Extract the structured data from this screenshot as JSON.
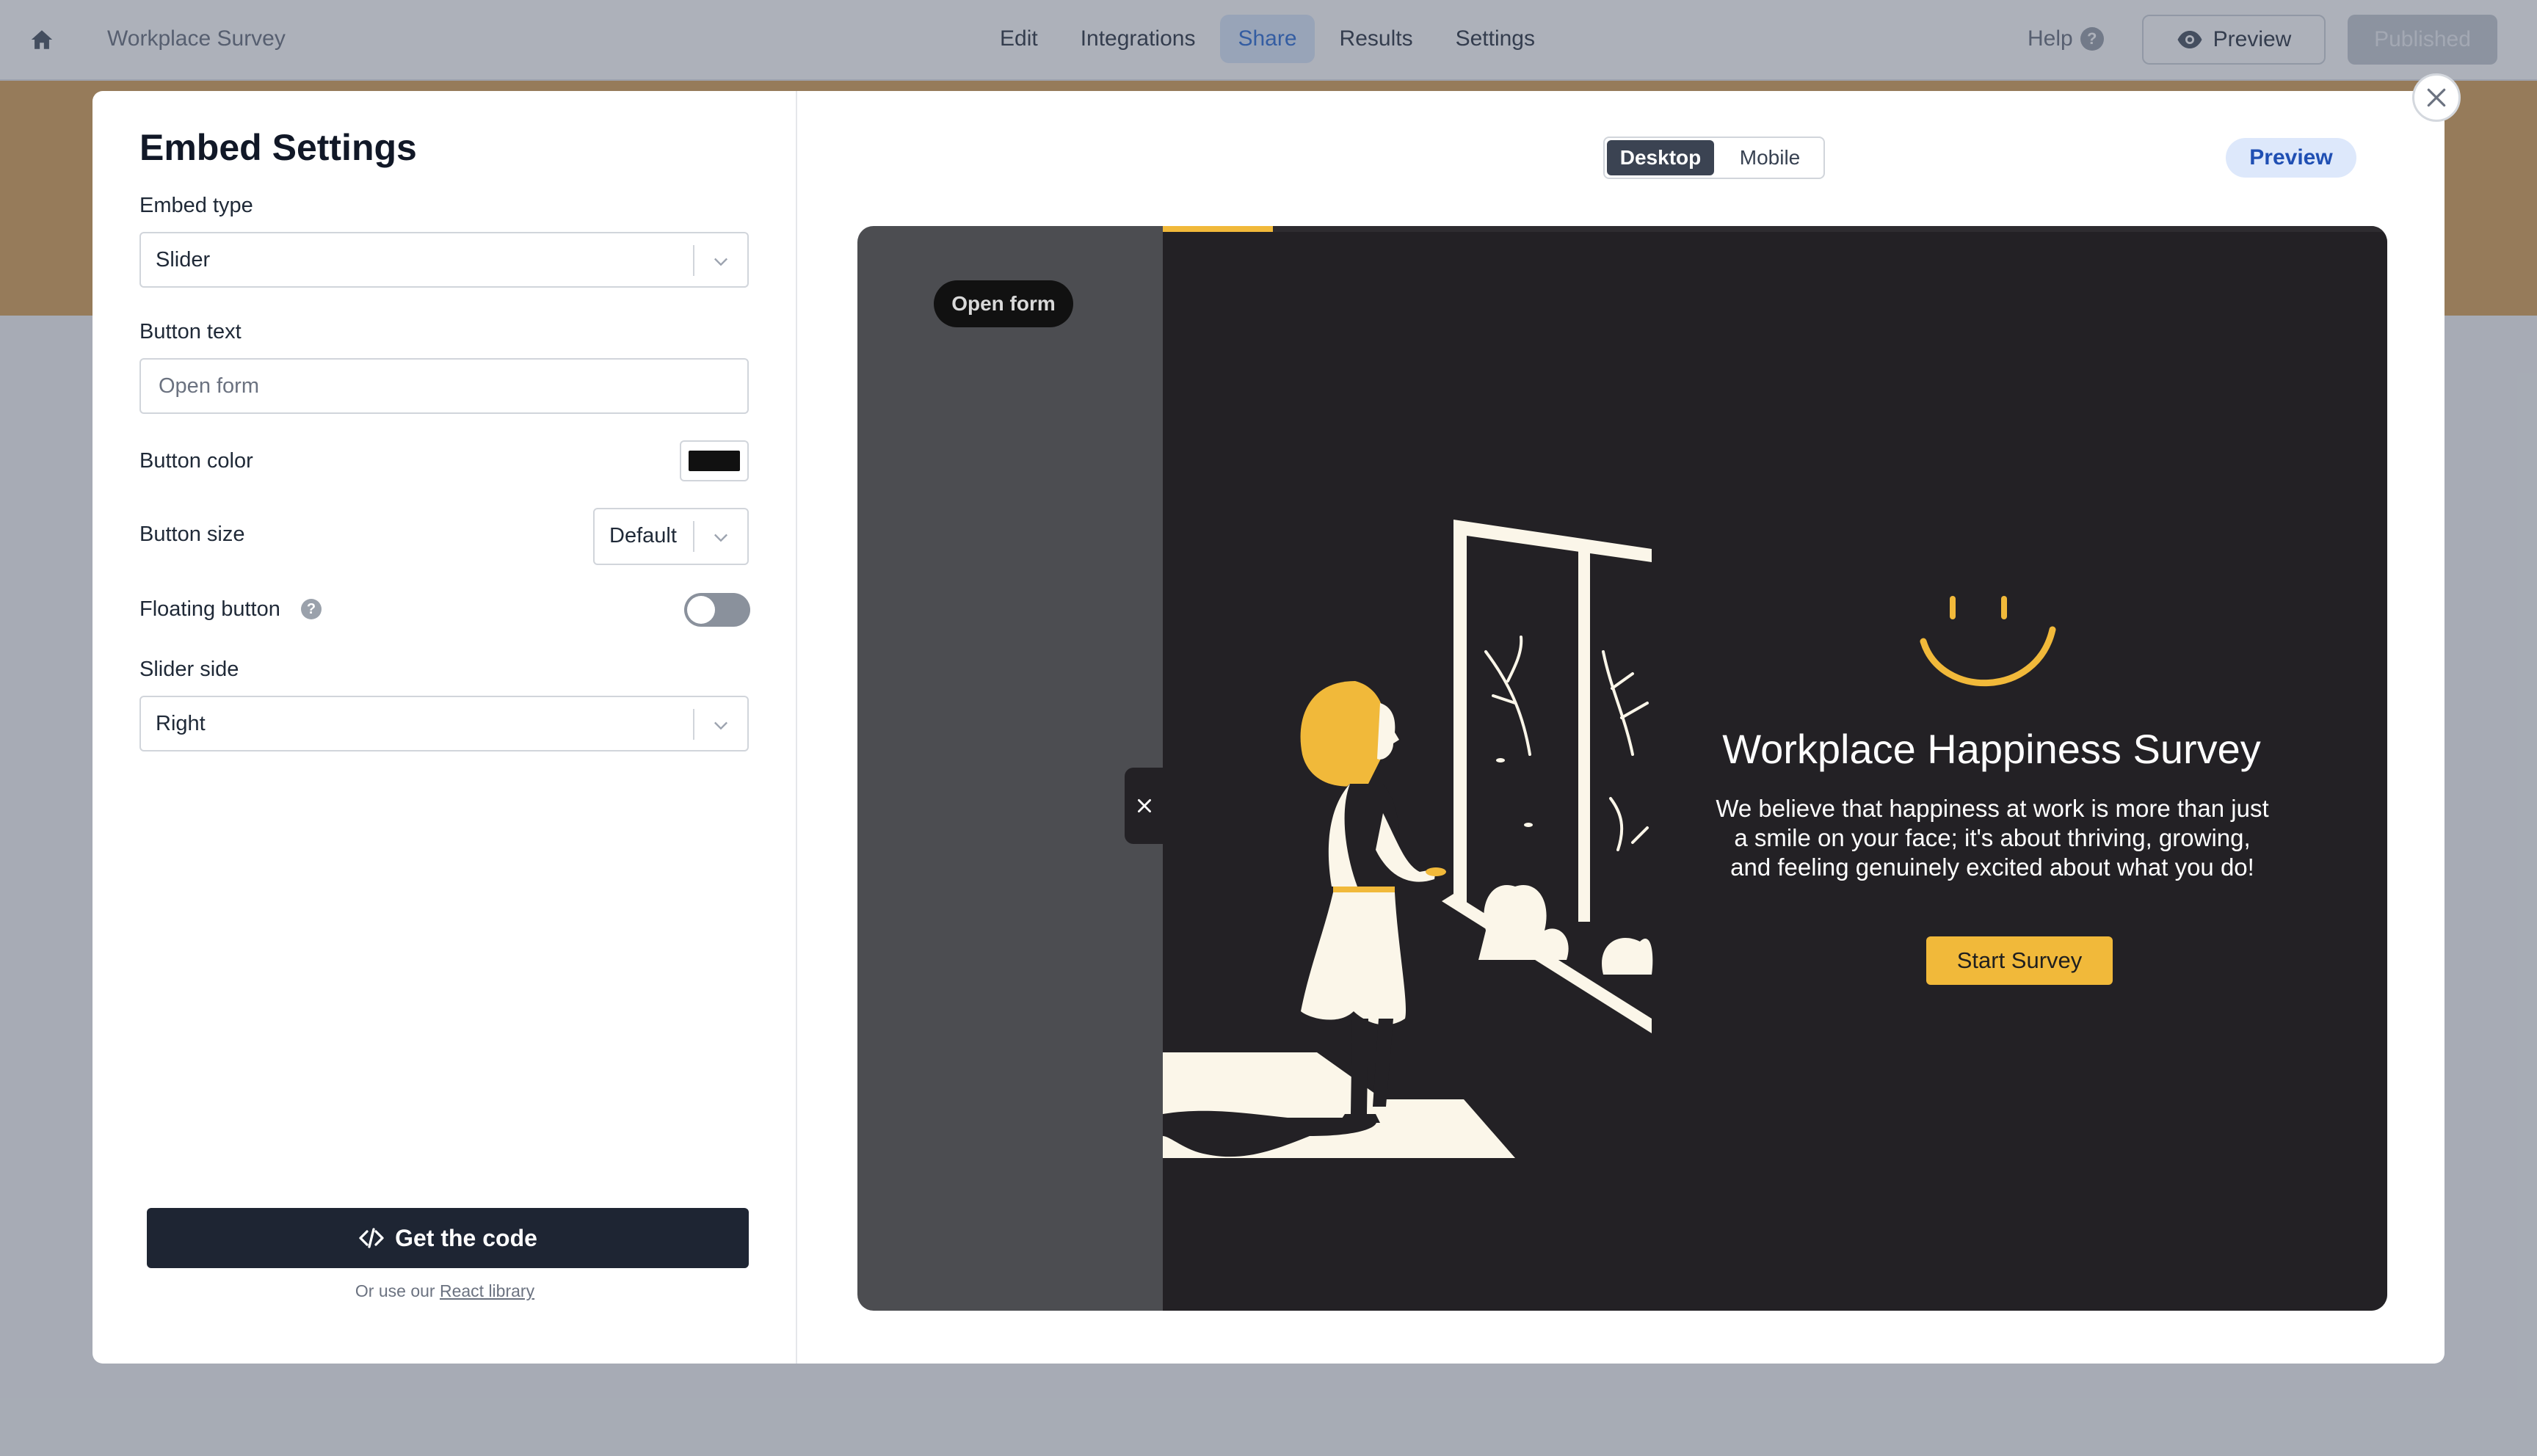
{
  "topbar": {
    "form_title": "Workplace Survey",
    "tabs": [
      {
        "label": "Edit"
      },
      {
        "label": "Integrations"
      },
      {
        "label": "Share"
      },
      {
        "label": "Results"
      },
      {
        "label": "Settings"
      }
    ],
    "active_tab": "Share",
    "help_label": "Help",
    "preview_label": "Preview",
    "published_label": "Published"
  },
  "embed": {
    "title": "Embed Settings",
    "embed_type_label": "Embed type",
    "embed_type_value": "Slider",
    "button_text_label": "Button text",
    "button_text_value": "Open form",
    "button_color_label": "Button color",
    "button_color_value": "#111111",
    "button_size_label": "Button size",
    "button_size_value": "Default",
    "floating_label": "Floating button",
    "floating_on": false,
    "slider_side_label": "Slider side",
    "slider_side_value": "Right",
    "get_code_label": "Get the code",
    "react_prefix": "Or use our",
    "react_link": "React library"
  },
  "preview": {
    "device_options": [
      "Desktop",
      "Mobile"
    ],
    "active_device": "Desktop",
    "preview_label": "Preview",
    "open_form_label": "Open form",
    "progress_fraction": 0.09
  },
  "survey": {
    "title": "Workplace Happiness Survey",
    "description": "We believe that happiness at work is more than just a smile on your face; it's about thriving, growing, and feeling genuinely excited about what you do!",
    "start_label": "Start Survey"
  },
  "colors": {
    "accent": "#f1b93a",
    "dark_panel": "#232125",
    "code_button": "#1e2533",
    "share_tab": "#2f6fd6"
  }
}
